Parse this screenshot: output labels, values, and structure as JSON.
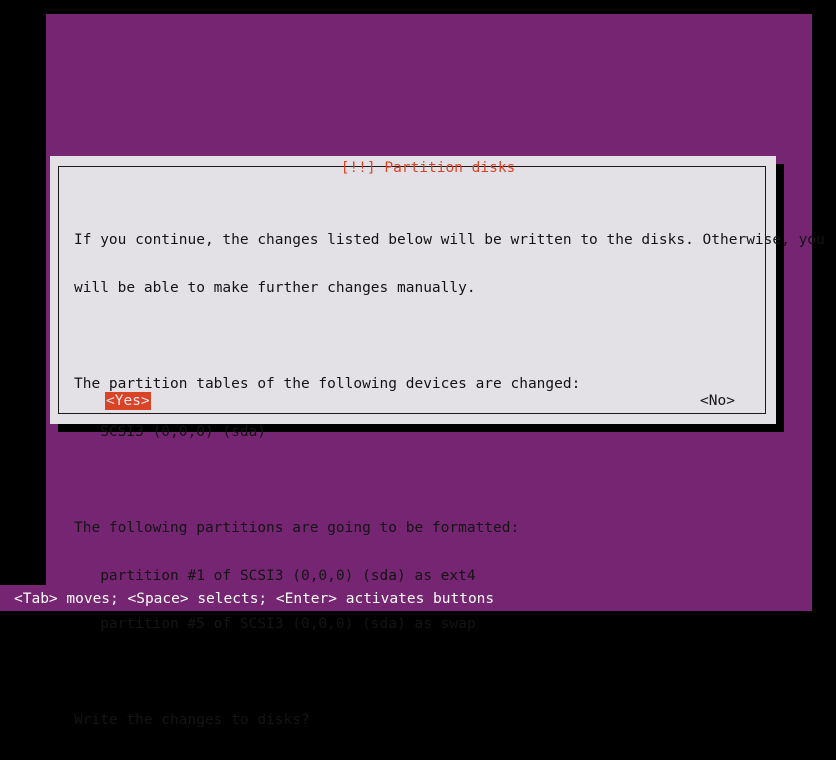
{
  "screen": {
    "background_color": "#762572",
    "frame_color": "#000000"
  },
  "dialog": {
    "title": "[!!] Partition disks",
    "title_color": "#d94426",
    "background_color": "#e4e1e6",
    "border_color": "#1a1a1a",
    "lines": [
      "If you continue, the changes listed below will be written to the disks. Otherwise, you",
      "will be able to make further changes manually.",
      "",
      "The partition tables of the following devices are changed:",
      "   SCSI3 (0,0,0) (sda)",
      "",
      "The following partitions are going to be formatted:",
      "   partition #1 of SCSI3 (0,0,0) (sda) as ext4",
      "   partition #5 of SCSI3 (0,0,0) (sda) as swap",
      "",
      "Write the changes to disks?"
    ],
    "buttons": {
      "yes": {
        "label": "<Yes>",
        "selected": true,
        "highlight_color": "#d94426",
        "text_color": "#e9e4ec"
      },
      "no": {
        "label": "<No>",
        "selected": false,
        "text_color": "#141414"
      }
    }
  },
  "helpbar": {
    "text": "<Tab> moves; <Space> selects; <Enter> activates buttons",
    "text_color": "#ffffff"
  }
}
